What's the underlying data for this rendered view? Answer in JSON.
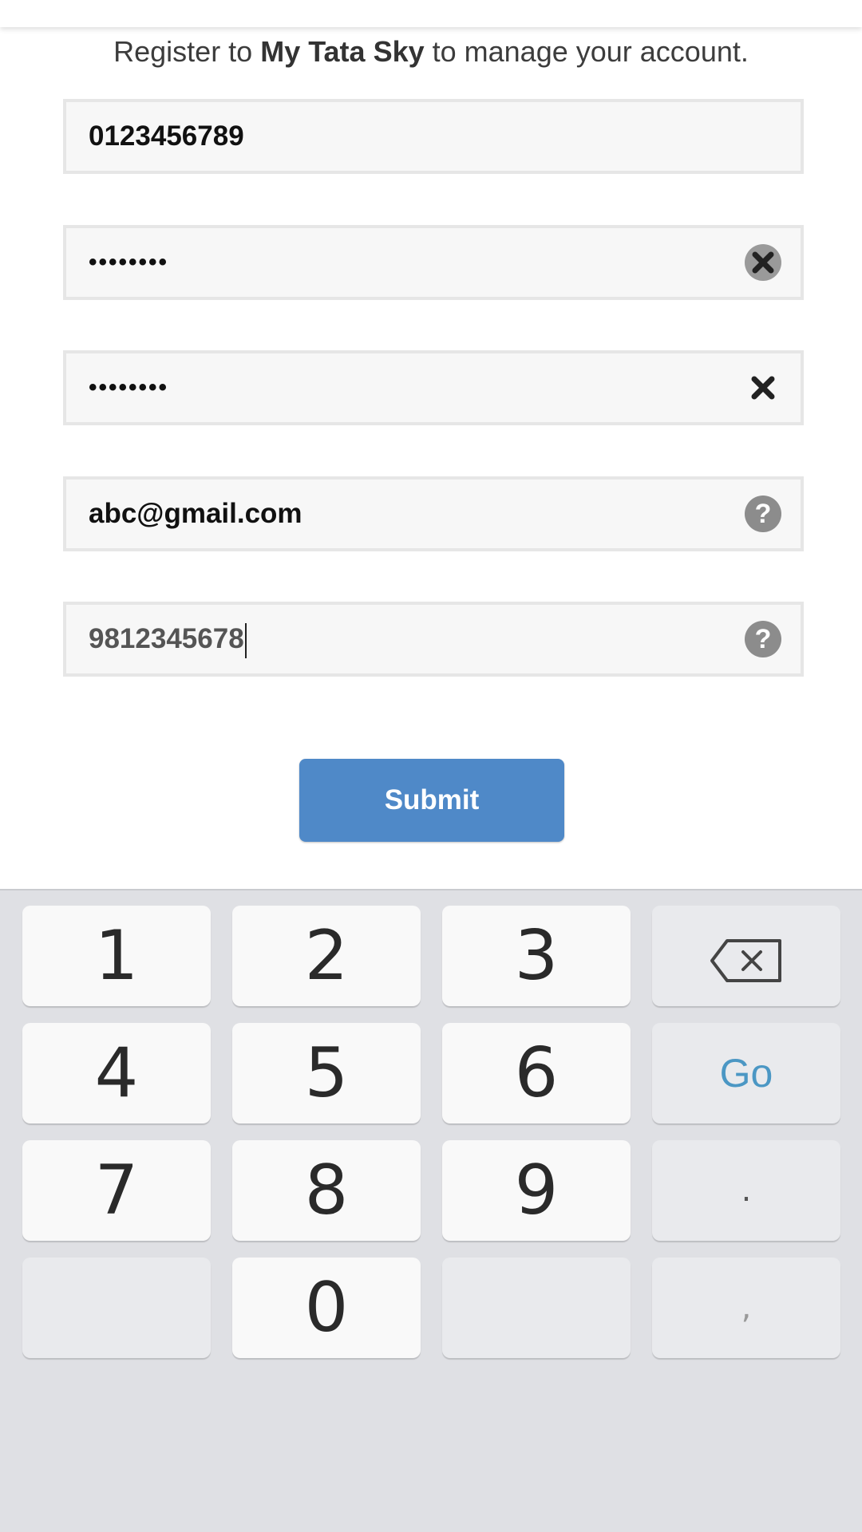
{
  "intro": {
    "prefix": "Register to ",
    "brand": "My Tata Sky",
    "suffix": " to manage your account."
  },
  "form": {
    "subscriber_id": "0123456789",
    "password": "••••••••",
    "confirm_password": "••••••••",
    "email": "abc@gmail.com",
    "mobile": "9812345678",
    "help_glyph": "?",
    "submit_label": "Submit"
  },
  "keyboard": {
    "keys": {
      "k1": "1",
      "k2": "2",
      "k3": "3",
      "k4": "4",
      "k5": "5",
      "k6": "6",
      "k7": "7",
      "k8": "8",
      "k9": "9",
      "k0": "0",
      "go": "Go",
      "period": ".",
      "comma": ","
    }
  },
  "colors": {
    "accent": "#4f89c8",
    "go": "#4b97c4",
    "keyboard_bg": "#dfe0e4"
  },
  "icons": {
    "clear": "close-icon",
    "help": "help-icon",
    "backspace": "backspace-icon"
  }
}
